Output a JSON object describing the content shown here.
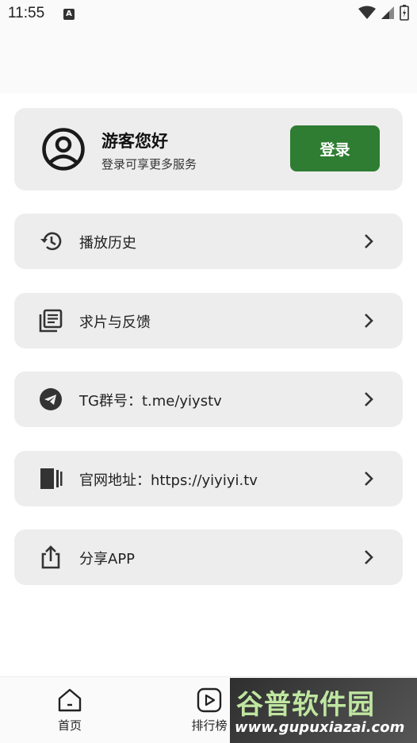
{
  "status_bar": {
    "time": "11:55",
    "notification_badge": "A"
  },
  "profile": {
    "title": "游客您好",
    "subtitle": "登录可享更多服务",
    "login_label": "登录"
  },
  "menu": [
    {
      "label": "播放历史",
      "icon": "history-icon"
    },
    {
      "label": "求片与反馈",
      "icon": "library-icon"
    },
    {
      "label": "TG群号：t.me/yiystv",
      "icon": "telegram-icon"
    },
    {
      "label": "官网地址：https://yiyiyi.tv",
      "icon": "website-icon"
    },
    {
      "label": "分享APP",
      "icon": "share-icon"
    }
  ],
  "bottom_nav": [
    {
      "label": "首页",
      "icon": "home-icon"
    },
    {
      "label": "排行榜",
      "icon": "play-icon"
    }
  ],
  "watermark": {
    "main": "谷普软件园",
    "url": "www.gupuxiazai.com"
  },
  "colors": {
    "accent": "#2e7d32",
    "card": "#ededed"
  }
}
